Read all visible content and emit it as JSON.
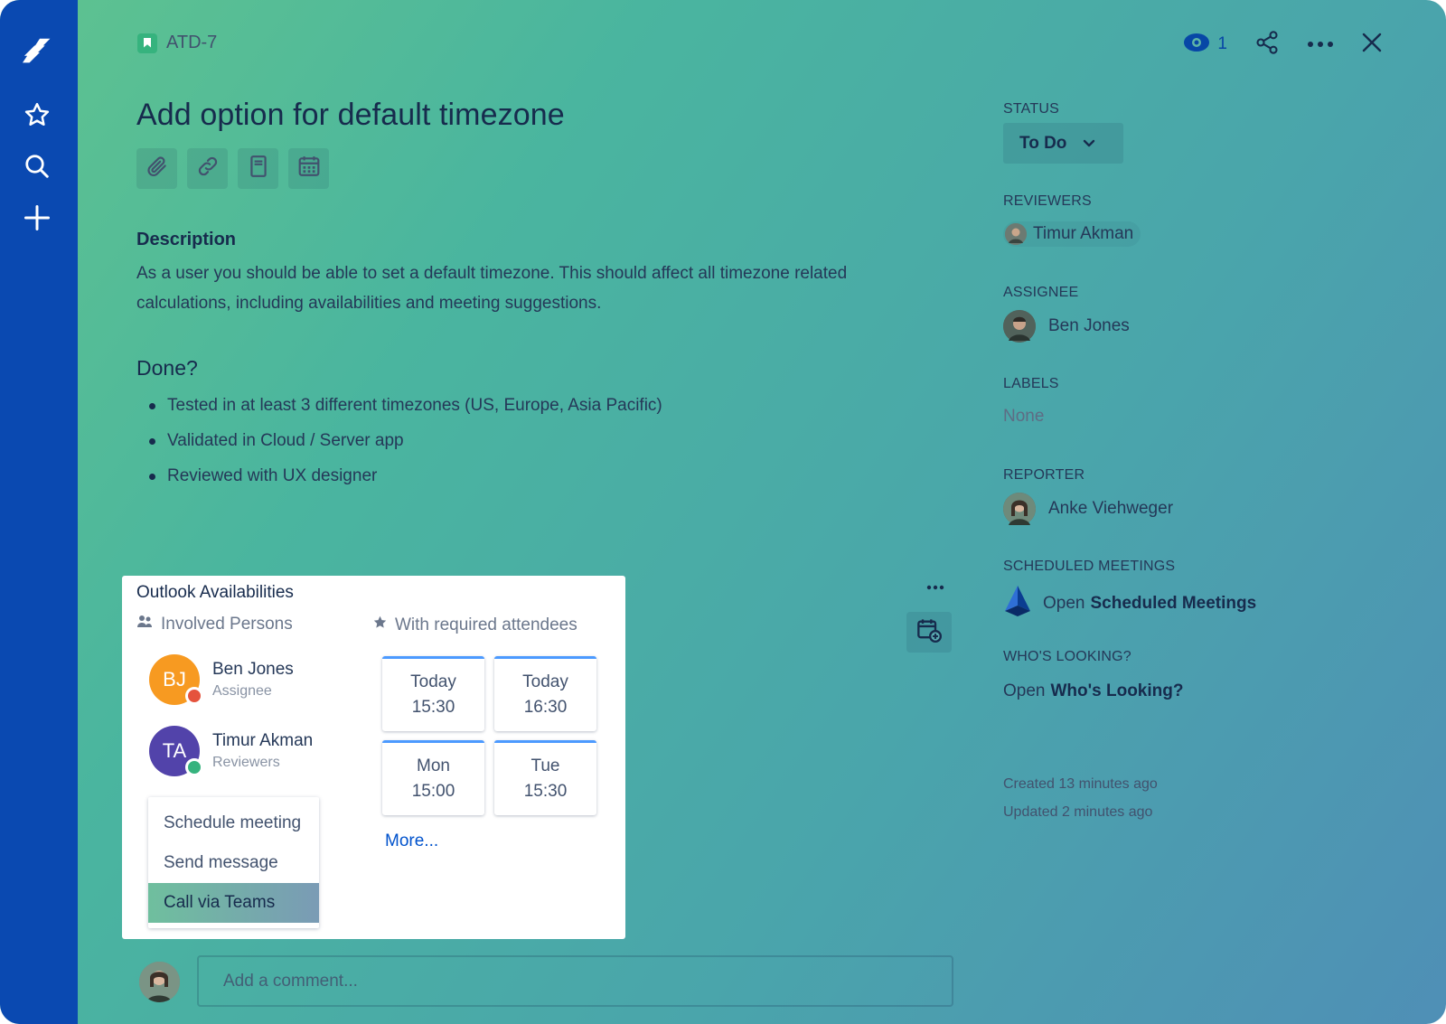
{
  "issue": {
    "key": "ATD-7",
    "title": "Add option for default timezone",
    "description_heading": "Description",
    "description": "As a user you should be able to set a default timezone. This should affect all timezone related calculations, including availabilities and meeting suggestions.",
    "done_heading": "Done?",
    "done_items": [
      "Tested in at least 3 different timezones (US, Europe, Asia Pacific)",
      "Validated in Cloud / Server app",
      "Reviewed with UX designer"
    ]
  },
  "header": {
    "watch_count": "1"
  },
  "outlook": {
    "title": "Outlook Availabilities",
    "involved_label": "Involved Persons",
    "attendees_label": "With required attendees",
    "persons": [
      {
        "initials": "BJ",
        "name": "Ben Jones",
        "role": "Assignee",
        "color": "#f79a21",
        "status_color": "#e5533d"
      },
      {
        "initials": "TA",
        "name": "Timur Akman",
        "role": "Reviewers",
        "color": "#5243aa",
        "status_color": "#36b37e"
      }
    ],
    "menu": [
      "Schedule meeting",
      "Send message",
      "Call via Teams"
    ],
    "slots": [
      {
        "day": "Today",
        "time": "15:30"
      },
      {
        "day": "Today",
        "time": "16:30"
      },
      {
        "day": "Mon",
        "time": "15:00"
      },
      {
        "day": "Tue",
        "time": "15:30"
      }
    ],
    "more_label": "More..."
  },
  "comment": {
    "placeholder": "Add a comment..."
  },
  "sidebar": {
    "status_label": "STATUS",
    "status_value": "To Do",
    "reviewers_label": "REVIEWERS",
    "reviewer": "Timur Akman",
    "assignee_label": "ASSIGNEE",
    "assignee": "Ben Jones",
    "labels_label": "LABELS",
    "labels_value": "None",
    "reporter_label": "REPORTER",
    "reporter": "Anke Viehweger",
    "scheduled_label": "SCHEDULED MEETINGS",
    "scheduled_open": "Open",
    "scheduled_link": "Scheduled Meetings",
    "looking_label": "WHO'S LOOKING?",
    "looking_open": "Open",
    "looking_link": "Who's Looking?",
    "created": "Created 13 minutes ago",
    "updated": "Updated 2 minutes ago"
  },
  "colors": {
    "nav": "#0a49b1",
    "link": "#0052cc",
    "slot_accent": "#4c9aff"
  }
}
